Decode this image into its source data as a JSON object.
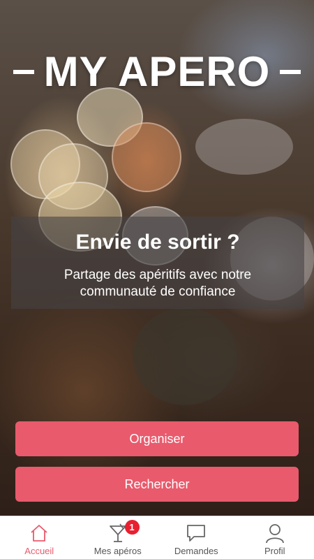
{
  "app": {
    "logo_text": "MY APERO"
  },
  "hero": {
    "title": "Envie de sortir ?",
    "subtitle": "Partage des apéritifs avec notre communauté de confiance"
  },
  "actions": {
    "organise_label": "Organiser",
    "search_label": "Rechercher"
  },
  "tabbar": {
    "items": [
      {
        "label": "Accueil",
        "icon": "home-icon",
        "active": true
      },
      {
        "label": "Mes apéros",
        "icon": "cocktail-glass-icon",
        "badge": "1"
      },
      {
        "label": "Demandes",
        "icon": "chat-bubble-icon"
      },
      {
        "label": "Profil",
        "icon": "person-icon"
      }
    ]
  },
  "colors": {
    "accent": "#e95a6c",
    "badge": "#e8202f"
  }
}
